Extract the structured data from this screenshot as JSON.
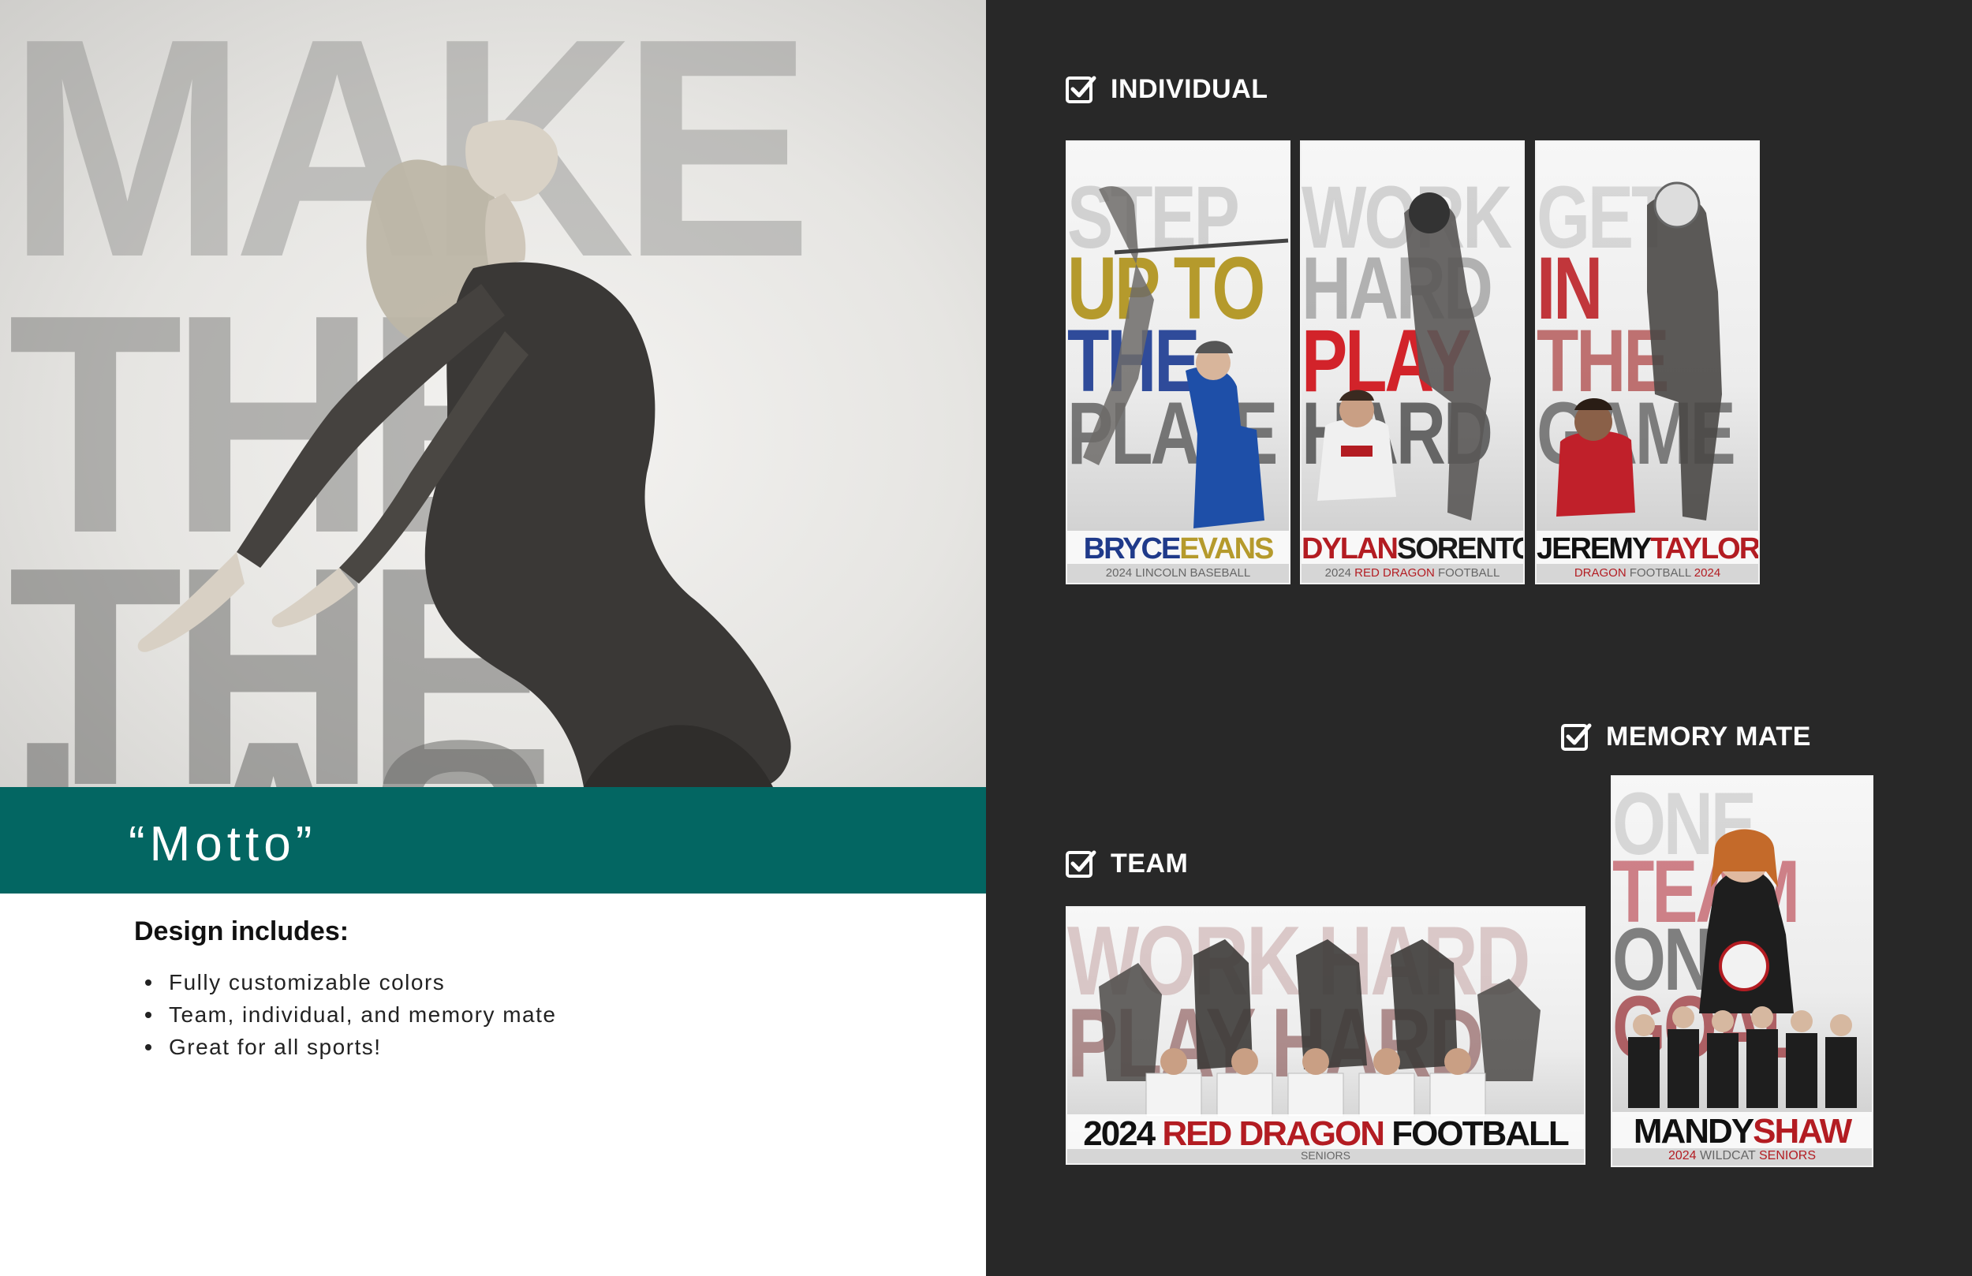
{
  "hero": {
    "background_words": [
      "MAKE",
      "THE",
      "THE",
      "LAS"
    ],
    "motto": "“Motto”",
    "band_color": "#036662"
  },
  "design": {
    "title": "Design includes:",
    "items": [
      "Fully customizable colors",
      "Team, individual, and memory mate",
      "Great for all sports!"
    ]
  },
  "sections": {
    "individual": {
      "label": "INDIVIDUAL",
      "icon": "checkbox-checked-icon"
    },
    "memory_mate": {
      "label": "MEMORY MATE",
      "icon": "checkbox-checked-icon"
    },
    "team": {
      "label": "TEAM",
      "icon": "checkbox-checked-icon"
    }
  },
  "posters": {
    "bryce": {
      "words": [
        "STEP",
        "UP TO",
        "THE",
        "PLATE"
      ],
      "first": "BRYCE",
      "last": "EVANS",
      "sub": [
        "2024 LINCOLN BASEBALL"
      ],
      "colors": {
        "first": "#1f3a8a",
        "last": "#b59a2c",
        "sub": "#777777"
      }
    },
    "dylan": {
      "words": [
        "WORK",
        "HARD",
        "PLAY",
        "HARD"
      ],
      "first": "DYLAN",
      "last": "SORENTO",
      "sub": [
        "2024 ",
        "RED DRAGON",
        " FOOTBALL"
      ],
      "colors": {
        "first": "#b31c22",
        "last": "#1a1a1a",
        "sub_accent": "#b31c22"
      }
    },
    "jeremy": {
      "words": [
        "GET",
        "IN",
        "THE",
        "GAME"
      ],
      "first": "JEREMY",
      "last": "TAYLOR",
      "sub": [
        "DRAGON",
        " FOOTBALL ",
        "2024"
      ],
      "colors": {
        "first": "#111111",
        "last": "#b31c22",
        "sub_accent": "#b31c22"
      }
    },
    "team": {
      "words": [
        "WORK HARD",
        "PLAY HARD"
      ],
      "year": "2024 ",
      "accent": "RED DRAGON",
      "rest": " FOOTBALL",
      "sub": "SENIORS",
      "colors": {
        "accent": "#b31c22",
        "text": "#111111"
      }
    },
    "mandy": {
      "words": [
        "ONE",
        "TEAM",
        "ONE",
        "GOAL"
      ],
      "first": "MANDY",
      "last": "SHAW",
      "sub": [
        "2024 ",
        "WILDCAT",
        " SENIORS"
      ],
      "colors": {
        "first": "#111111",
        "last": "#b31c22",
        "sub_accent": "#b31c22"
      }
    }
  }
}
